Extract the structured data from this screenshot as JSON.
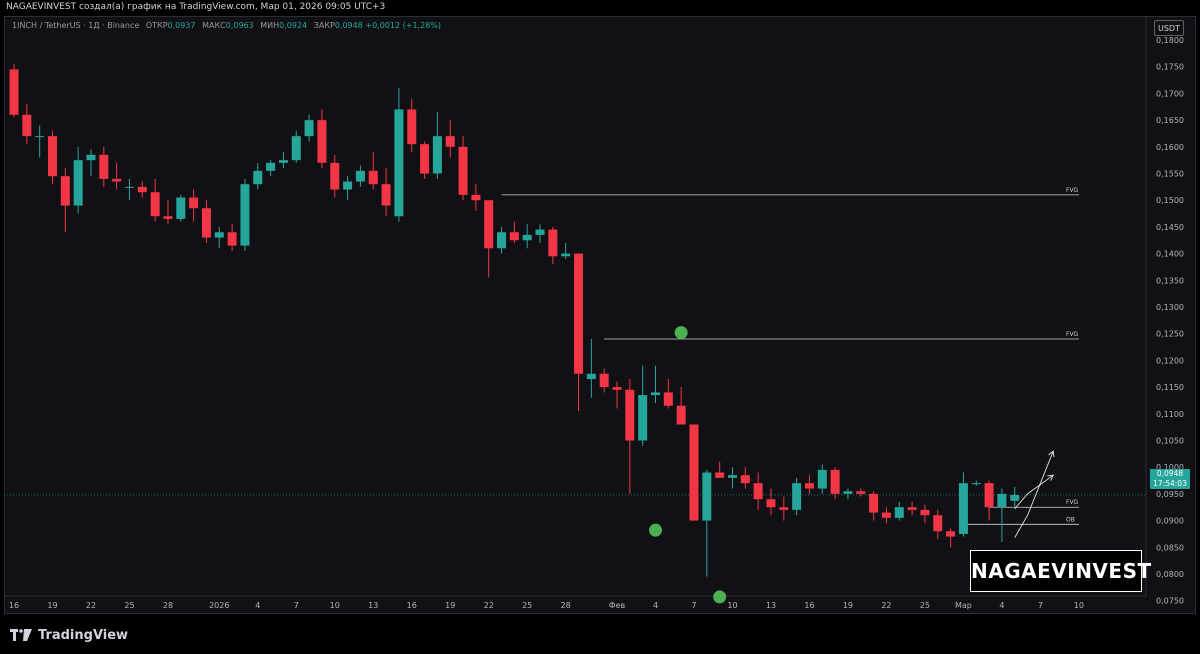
{
  "header": {
    "text": "NAGAEVINVEST создал(а) график на TradingView.com, Мар 01, 2026 09:05 UTC+3"
  },
  "legend": {
    "symbol": "1INCH / TetherUS · 1Д · Binance",
    "open_label": "ОТКР",
    "open": "0,0937",
    "high_label": "МАКС",
    "high": "0,0963",
    "low_label": "МИН",
    "low": "0,0924",
    "close_label": "ЗАКР",
    "close": "0,0948",
    "change": "+0,0012 (+1,28%)"
  },
  "currency_button": "USDT",
  "price_tag": {
    "price": "0,0948",
    "countdown": "17:54:03"
  },
  "watermark": "NAGAEVINVEST",
  "footer": {
    "brand": "TradingView"
  },
  "colors": {
    "up": "#26a69a",
    "down": "#f23645",
    "marker": "#4caf50",
    "level": "#d1d4dc",
    "background": "#111115"
  },
  "chart_data": {
    "type": "candlestick",
    "y_axis_labels": [
      "0,1800",
      "0,1750",
      "0,1700",
      "0,1650",
      "0,1600",
      "0,1550",
      "0,1500",
      "0,1450",
      "0,1400",
      "0,1350",
      "0,1300",
      "0,1250",
      "0,1200",
      "0,1150",
      "0,1100",
      "0,1050",
      "0,1000",
      "0,0950",
      "0,0900",
      "0,0850",
      "0,0800",
      "0,0750"
    ],
    "ylim": [
      0.0725,
      0.1845
    ],
    "x_ticks": [
      {
        "day": 0,
        "label": "16"
      },
      {
        "day": 3,
        "label": "19"
      },
      {
        "day": 6,
        "label": "22"
      },
      {
        "day": 9,
        "label": "25"
      },
      {
        "day": 12,
        "label": "28"
      },
      {
        "day": 16,
        "label": "2026"
      },
      {
        "day": 19,
        "label": "4"
      },
      {
        "day": 22,
        "label": "7"
      },
      {
        "day": 25,
        "label": "10"
      },
      {
        "day": 28,
        "label": "13"
      },
      {
        "day": 31,
        "label": "16"
      },
      {
        "day": 34,
        "label": "19"
      },
      {
        "day": 37,
        "label": "22"
      },
      {
        "day": 40,
        "label": "25"
      },
      {
        "day": 43,
        "label": "28"
      },
      {
        "day": 47,
        "label": "Фев"
      },
      {
        "day": 50,
        "label": "4"
      },
      {
        "day": 53,
        "label": "7"
      },
      {
        "day": 56,
        "label": "10"
      },
      {
        "day": 59,
        "label": "13"
      },
      {
        "day": 62,
        "label": "16"
      },
      {
        "day": 65,
        "label": "19"
      },
      {
        "day": 68,
        "label": "22"
      },
      {
        "day": 71,
        "label": "25"
      },
      {
        "day": 74,
        "label": "Мар"
      },
      {
        "day": 77,
        "label": "4"
      },
      {
        "day": 80,
        "label": "7"
      },
      {
        "day": 83,
        "label": "10"
      }
    ],
    "candles": [
      [
        0.1745,
        0.1755,
        0.1655,
        0.166
      ],
      [
        0.166,
        0.168,
        0.1605,
        0.162
      ],
      [
        0.162,
        0.164,
        0.158,
        0.162
      ],
      [
        0.162,
        0.163,
        0.153,
        0.1545
      ],
      [
        0.1545,
        0.156,
        0.144,
        0.149
      ],
      [
        0.149,
        0.16,
        0.1475,
        0.1575
      ],
      [
        0.1575,
        0.1595,
        0.1545,
        0.1585
      ],
      [
        0.1585,
        0.16,
        0.1525,
        0.154
      ],
      [
        0.154,
        0.157,
        0.152,
        0.1535
      ],
      [
        0.1525,
        0.154,
        0.15,
        0.1525
      ],
      [
        0.1525,
        0.1535,
        0.1505,
        0.1515
      ],
      [
        0.1515,
        0.154,
        0.146,
        0.147
      ],
      [
        0.147,
        0.15,
        0.1455,
        0.1465
      ],
      [
        0.1465,
        0.151,
        0.146,
        0.1505
      ],
      [
        0.1505,
        0.152,
        0.146,
        0.1485
      ],
      [
        0.1485,
        0.15,
        0.142,
        0.143
      ],
      [
        0.143,
        0.145,
        0.141,
        0.144
      ],
      [
        0.144,
        0.1455,
        0.1405,
        0.1415
      ],
      [
        0.1415,
        0.154,
        0.1405,
        0.153
      ],
      [
        0.153,
        0.157,
        0.152,
        0.1555
      ],
      [
        0.1555,
        0.1575,
        0.1545,
        0.157
      ],
      [
        0.157,
        0.159,
        0.156,
        0.1575
      ],
      [
        0.1575,
        0.163,
        0.157,
        0.162
      ],
      [
        0.162,
        0.166,
        0.161,
        0.165
      ],
      [
        0.165,
        0.167,
        0.156,
        0.157
      ],
      [
        0.157,
        0.1585,
        0.1505,
        0.152
      ],
      [
        0.152,
        0.1545,
        0.15,
        0.1535
      ],
      [
        0.1535,
        0.1565,
        0.1525,
        0.1555
      ],
      [
        0.1555,
        0.159,
        0.152,
        0.153
      ],
      [
        0.153,
        0.156,
        0.147,
        0.149
      ],
      [
        0.147,
        0.171,
        0.146,
        0.167
      ],
      [
        0.167,
        0.169,
        0.159,
        0.1605
      ],
      [
        0.1605,
        0.161,
        0.154,
        0.155
      ],
      [
        0.155,
        0.1665,
        0.154,
        0.162
      ],
      [
        0.162,
        0.165,
        0.158,
        0.16
      ],
      [
        0.16,
        0.162,
        0.15,
        0.151
      ],
      [
        0.151,
        0.153,
        0.148,
        0.15
      ],
      [
        0.15,
        0.15,
        0.1355,
        0.141
      ],
      [
        0.141,
        0.145,
        0.14,
        0.144
      ],
      [
        0.144,
        0.146,
        0.142,
        0.1425
      ],
      [
        0.1425,
        0.1455,
        0.141,
        0.1435
      ],
      [
        0.1435,
        0.1455,
        0.142,
        0.1445
      ],
      [
        0.1445,
        0.145,
        0.138,
        0.1395
      ],
      [
        0.1395,
        0.142,
        0.139,
        0.14
      ],
      [
        0.14,
        0.14,
        0.1105,
        0.1175
      ],
      [
        0.1165,
        0.124,
        0.113,
        0.1175
      ],
      [
        0.1175,
        0.1185,
        0.114,
        0.115
      ],
      [
        0.115,
        0.116,
        0.111,
        0.1145
      ],
      [
        0.1145,
        0.1165,
        0.095,
        0.105
      ],
      [
        0.105,
        0.119,
        0.104,
        0.1135
      ],
      [
        0.1135,
        0.119,
        0.112,
        0.114
      ],
      [
        0.114,
        0.1165,
        0.111,
        0.1115
      ],
      [
        0.1115,
        0.115,
        0.108,
        0.108
      ],
      [
        0.108,
        0.108,
        0.09,
        0.09
      ],
      [
        0.09,
        0.0995,
        0.0795,
        0.099
      ],
      [
        0.099,
        0.101,
        0.098,
        0.098
      ],
      [
        0.098,
        0.1,
        0.096,
        0.0985
      ],
      [
        0.0985,
        0.1,
        0.096,
        0.097
      ],
      [
        0.097,
        0.099,
        0.092,
        0.094
      ],
      [
        0.094,
        0.096,
        0.091,
        0.0925
      ],
      [
        0.0925,
        0.0945,
        0.09,
        0.092
      ],
      [
        0.092,
        0.098,
        0.091,
        0.097
      ],
      [
        0.097,
        0.0985,
        0.095,
        0.096
      ],
      [
        0.096,
        0.1005,
        0.095,
        0.0995
      ],
      [
        0.0995,
        0.1,
        0.094,
        0.095
      ],
      [
        0.095,
        0.096,
        0.094,
        0.0955
      ],
      [
        0.0955,
        0.096,
        0.0945,
        0.095
      ],
      [
        0.095,
        0.0955,
        0.09,
        0.0915
      ],
      [
        0.0915,
        0.0925,
        0.0895,
        0.0905
      ],
      [
        0.0905,
        0.0935,
        0.09,
        0.0925
      ],
      [
        0.0925,
        0.0935,
        0.091,
        0.092
      ],
      [
        0.092,
        0.093,
        0.0895,
        0.091
      ],
      [
        0.091,
        0.092,
        0.0865,
        0.088
      ],
      [
        0.088,
        0.0885,
        0.085,
        0.087
      ],
      [
        0.0875,
        0.099,
        0.087,
        0.097
      ],
      [
        0.097,
        0.0975,
        0.0965,
        0.097
      ],
      [
        0.097,
        0.0975,
        0.09,
        0.0925
      ],
      [
        0.0925,
        0.096,
        0.086,
        0.095
      ],
      [
        0.0937,
        0.0963,
        0.0924,
        0.0948
      ]
    ],
    "levels": [
      {
        "label": "FVG",
        "price": 0.151,
        "from_day": 38
      },
      {
        "label": "FVG",
        "price": 0.124,
        "from_day": 46
      },
      {
        "label": "FVG",
        "price": 0.0925,
        "from_day": 76
      },
      {
        "label": "OB",
        "price": 0.0893,
        "from_day": 74
      }
    ],
    "markers": [
      {
        "day": 52,
        "price": 0.1252
      },
      {
        "day": 50,
        "price": 0.0882
      },
      {
        "day": 55,
        "price": 0.0757
      }
    ],
    "current_price": 0.0948,
    "projection_paths": [
      [
        [
          78,
          0.0922
        ],
        [
          79,
          0.095
        ],
        [
          81,
          0.0985
        ]
      ],
      [
        [
          78,
          0.0868
        ],
        [
          79,
          0.091
        ],
        [
          81,
          0.103
        ]
      ]
    ]
  }
}
